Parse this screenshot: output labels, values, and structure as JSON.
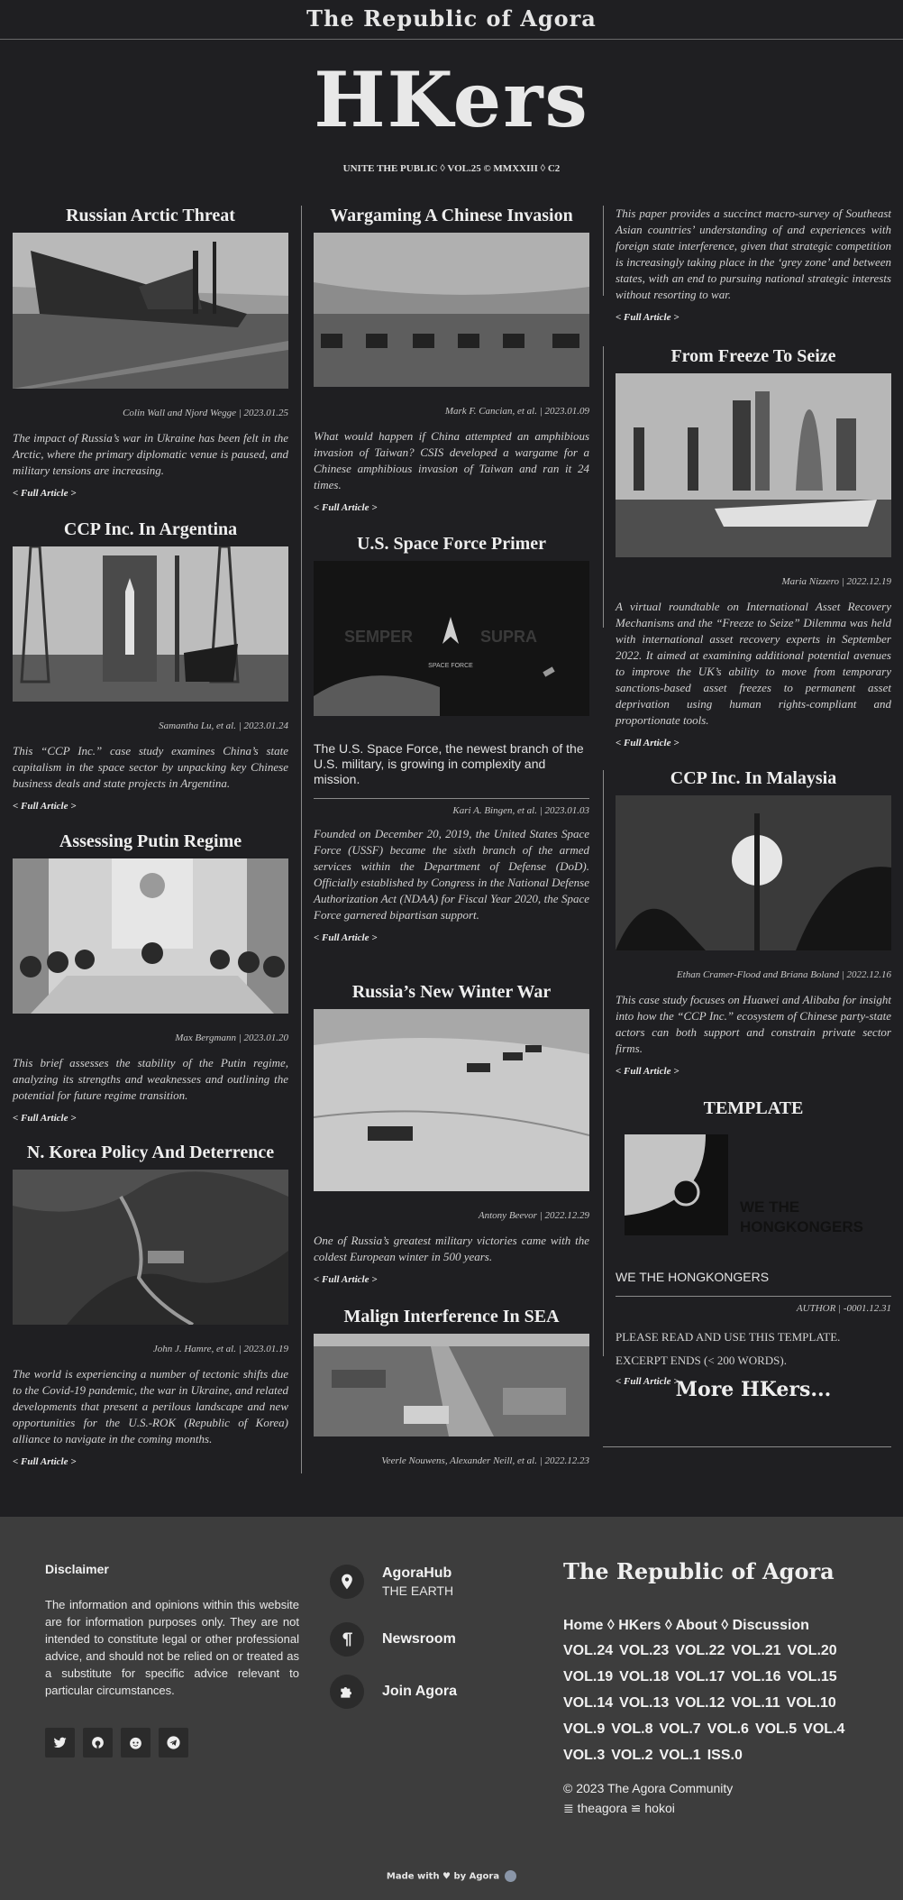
{
  "header": {
    "brand": "The Republic of Agora"
  },
  "masthead": {
    "logo": "HKers",
    "tagline": "UNITE THE PUBLIC ◊ VOL.25 © MMXXIII ◊ C2"
  },
  "full_article_label": "< Full Article >",
  "articles": {
    "russian_arctic": {
      "title": "Russian Arctic Threat",
      "byline": "Colin Wall and Njord Wegge | 2023.01.25",
      "summary": "The impact of Russia’s war in Ukraine has been felt in the Arctic, where the primary diplomatic venue is paused, and military tensions are increasing."
    },
    "ccp_argentina": {
      "title": "CCP Inc. In Argentina",
      "byline": "Samantha Lu, et al. | 2023.01.24",
      "summary": "This “CCP Inc.” case study examines China’s state capitalism in the space sector by unpacking key Chinese business deals and state projects in Argentina."
    },
    "putin_regime": {
      "title": "Assessing Putin Regime",
      "byline": "Max Bergmann | 2023.01.20",
      "summary": "This brief assesses the stability of the Putin regime, analyzing its strengths and weaknesses and outlining the potential for future regime transition."
    },
    "nkorea": {
      "title": "N. Korea Policy And Deterrence",
      "byline": "John J. Hamre, et al. | 2023.01.19",
      "summary": "The world is experiencing a number of tectonic shifts due to the Covid-19 pandemic, the war in Ukraine, and related developments that present a perilous landscape and new opportunities for the U.S.-ROK (Republic of Korea) alliance to navigate in the coming months."
    },
    "wargaming": {
      "title": "Wargaming A Chinese Invasion",
      "byline": "Mark F. Cancian, et al. | 2023.01.09",
      "summary": "What would happen if China attempted an amphibious invasion of Taiwan? CSIS developed a wargame for a Chinese amphibious invasion of Taiwan and ran it 24 times."
    },
    "space_force": {
      "title": "U.S. Space Force Primer",
      "image_text_left": "SEMPER",
      "image_text_right": "SUPRA",
      "image_caption": "SPACE FORCE",
      "lead": "The U.S. Space Force, the newest branch of the U.S. military, is growing in complexity and mission.",
      "byline": "Kari A. Bingen, et al. | 2023.01.03",
      "summary": "Founded on December 20, 2019, the United States Space Force (USSF) became the sixth branch of the armed services within the Department of Defense (DoD). Officially established by Congress in the National Defense Authorization Act (NDAA) for Fiscal Year 2020, the Space Force garnered bipartisan support."
    },
    "winter_war": {
      "title": "Russia’s New Winter War",
      "byline": "Antony Beevor | 2022.12.29",
      "summary": "One of Russia’s greatest military victories came with the coldest European winter in 500 years."
    },
    "malign_sea": {
      "title": "Malign Interference In SEA",
      "byline": "Veerle Nouwens, Alexander Neill, et al. | 2022.12.23"
    },
    "sea_cont": {
      "summary": "This paper provides a succinct macro-survey of Southeast Asian countries’ understanding of and experiences with foreign state interference, given that strategic competition is increasingly taking place in the ‘grey zone’ and between states, with an end to pursuing national strategic interests without resorting to war."
    },
    "freeze_seize": {
      "title": "From Freeze To Seize",
      "byline": "Maria Nizzero | 2022.12.19",
      "summary": "A virtual roundtable on International Asset Recovery Mechanisms and the “Freeze to Seize” Dilemma was held with international asset recovery experts in September 2022. It aimed at examining additional potential avenues to improve the UK’s ability to move from temporary sanctions-based asset freezes to permanent asset deprivation using human rights-compliant and proportionate tools."
    },
    "ccp_malaysia": {
      "title": "CCP Inc. In Malaysia",
      "byline": "Ethan Cramer-Flood and Briana Boland | 2022.12.16",
      "summary": "This case study focuses on Huawei and Alibaba for insight into how the “CCP Inc.” ecosystem of Chinese party-state actors can both support and constrain private sector firms."
    },
    "template": {
      "title": "TEMPLATE",
      "image_text_1": "WE THE",
      "image_text_2": "HONGKONGERS",
      "lead": "WE THE HONGKONGERS",
      "byline": "AUTHOR | -0001.12.31",
      "summary_1": "PLEASE READ AND USE THIS TEMPLATE.",
      "summary_2": "EXCERPT ENDS (< 200 WORDS)."
    }
  },
  "more_link": "More HKers...",
  "footer": {
    "disclaimer_title": "Disclaimer",
    "disclaimer_text": "The information and opinions within this website are for information purposes only. They are not intended to constitute legal or other professional advice, and should not be relied on or treated as a substitute for specific advice relevant to particular circumstances.",
    "items": [
      {
        "title": "AgoraHub",
        "subtitle": "THE EARTH",
        "icon": "location-pin-icon"
      },
      {
        "title": "Newsroom",
        "icon": "pilcrow-icon"
      },
      {
        "title": "Join Agora",
        "icon": "puzzle-icon"
      }
    ],
    "brand": "The Republic of Agora",
    "nav": [
      "Home",
      "HKers",
      "About",
      "Discussion"
    ],
    "nav_sep": " ◊ ",
    "volumes": [
      "VOL.24",
      "VOL.23",
      "VOL.22",
      "VOL.21",
      "VOL.20",
      "VOL.19",
      "VOL.18",
      "VOL.17",
      "VOL.16",
      "VOL.15",
      "VOL.14",
      "VOL.13",
      "VOL.12",
      "VOL.11",
      "VOL.10",
      "VOL.9",
      "VOL.8",
      "VOL.7",
      "VOL.6",
      "VOL.5",
      "VOL.4",
      "VOL.3",
      "VOL.2",
      "VOL.1",
      "ISS.0"
    ],
    "copyright": "© 2023 The Agora Community",
    "links": "≣ theagora ≌ hokoi",
    "made_with": "Made with ♥ by Agora"
  }
}
